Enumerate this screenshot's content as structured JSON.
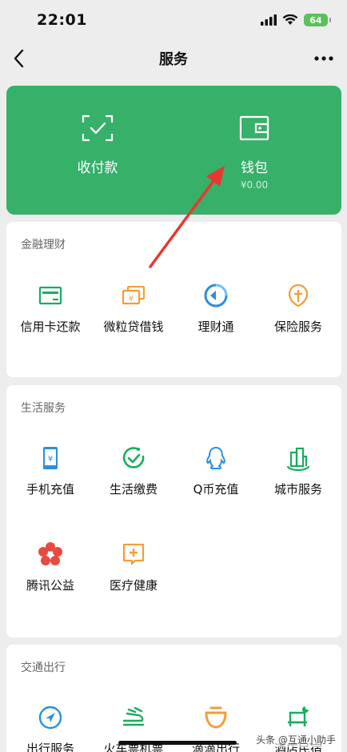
{
  "status": {
    "time": "22:01",
    "battery": "64"
  },
  "nav": {
    "title": "服务"
  },
  "hero": {
    "pay_label": "收付款",
    "wallet_label": "钱包",
    "wallet_balance": "¥0.00"
  },
  "finance": {
    "title": "金融理财",
    "items": [
      {
        "label": "信用卡还款",
        "icon": "credit-card-icon"
      },
      {
        "label": "微粒贷借钱",
        "icon": "loan-icon"
      },
      {
        "label": "理财通",
        "icon": "wealth-icon"
      },
      {
        "label": "保险服务",
        "icon": "insurance-icon"
      }
    ]
  },
  "life": {
    "title": "生活服务",
    "items": [
      {
        "label": "手机充值",
        "icon": "phone-topup-icon"
      },
      {
        "label": "生活缴费",
        "icon": "bill-payment-icon"
      },
      {
        "label": "Q币充值",
        "icon": "qq-coin-icon"
      },
      {
        "label": "城市服务",
        "icon": "city-service-icon"
      },
      {
        "label": "腾讯公益",
        "icon": "charity-icon"
      },
      {
        "label": "医疗健康",
        "icon": "medical-icon"
      }
    ]
  },
  "transport": {
    "title": "交通出行",
    "items": [
      {
        "label": "出行服务",
        "icon": "travel-icon"
      },
      {
        "label": "火车票机票",
        "icon": "train-ticket-icon"
      },
      {
        "label": "滴滴出行",
        "icon": "didi-icon"
      },
      {
        "label": "酒店民宿",
        "icon": "hotel-icon"
      }
    ]
  },
  "colors": {
    "accent": "#37b06a",
    "icon_green": "#1aad5f",
    "icon_orange": "#f29d38",
    "icon_blue": "#2b8fdc",
    "icon_red": "#e84a3f",
    "arrow": "#e8382f"
  },
  "watermark": "头条 @互通小助手"
}
